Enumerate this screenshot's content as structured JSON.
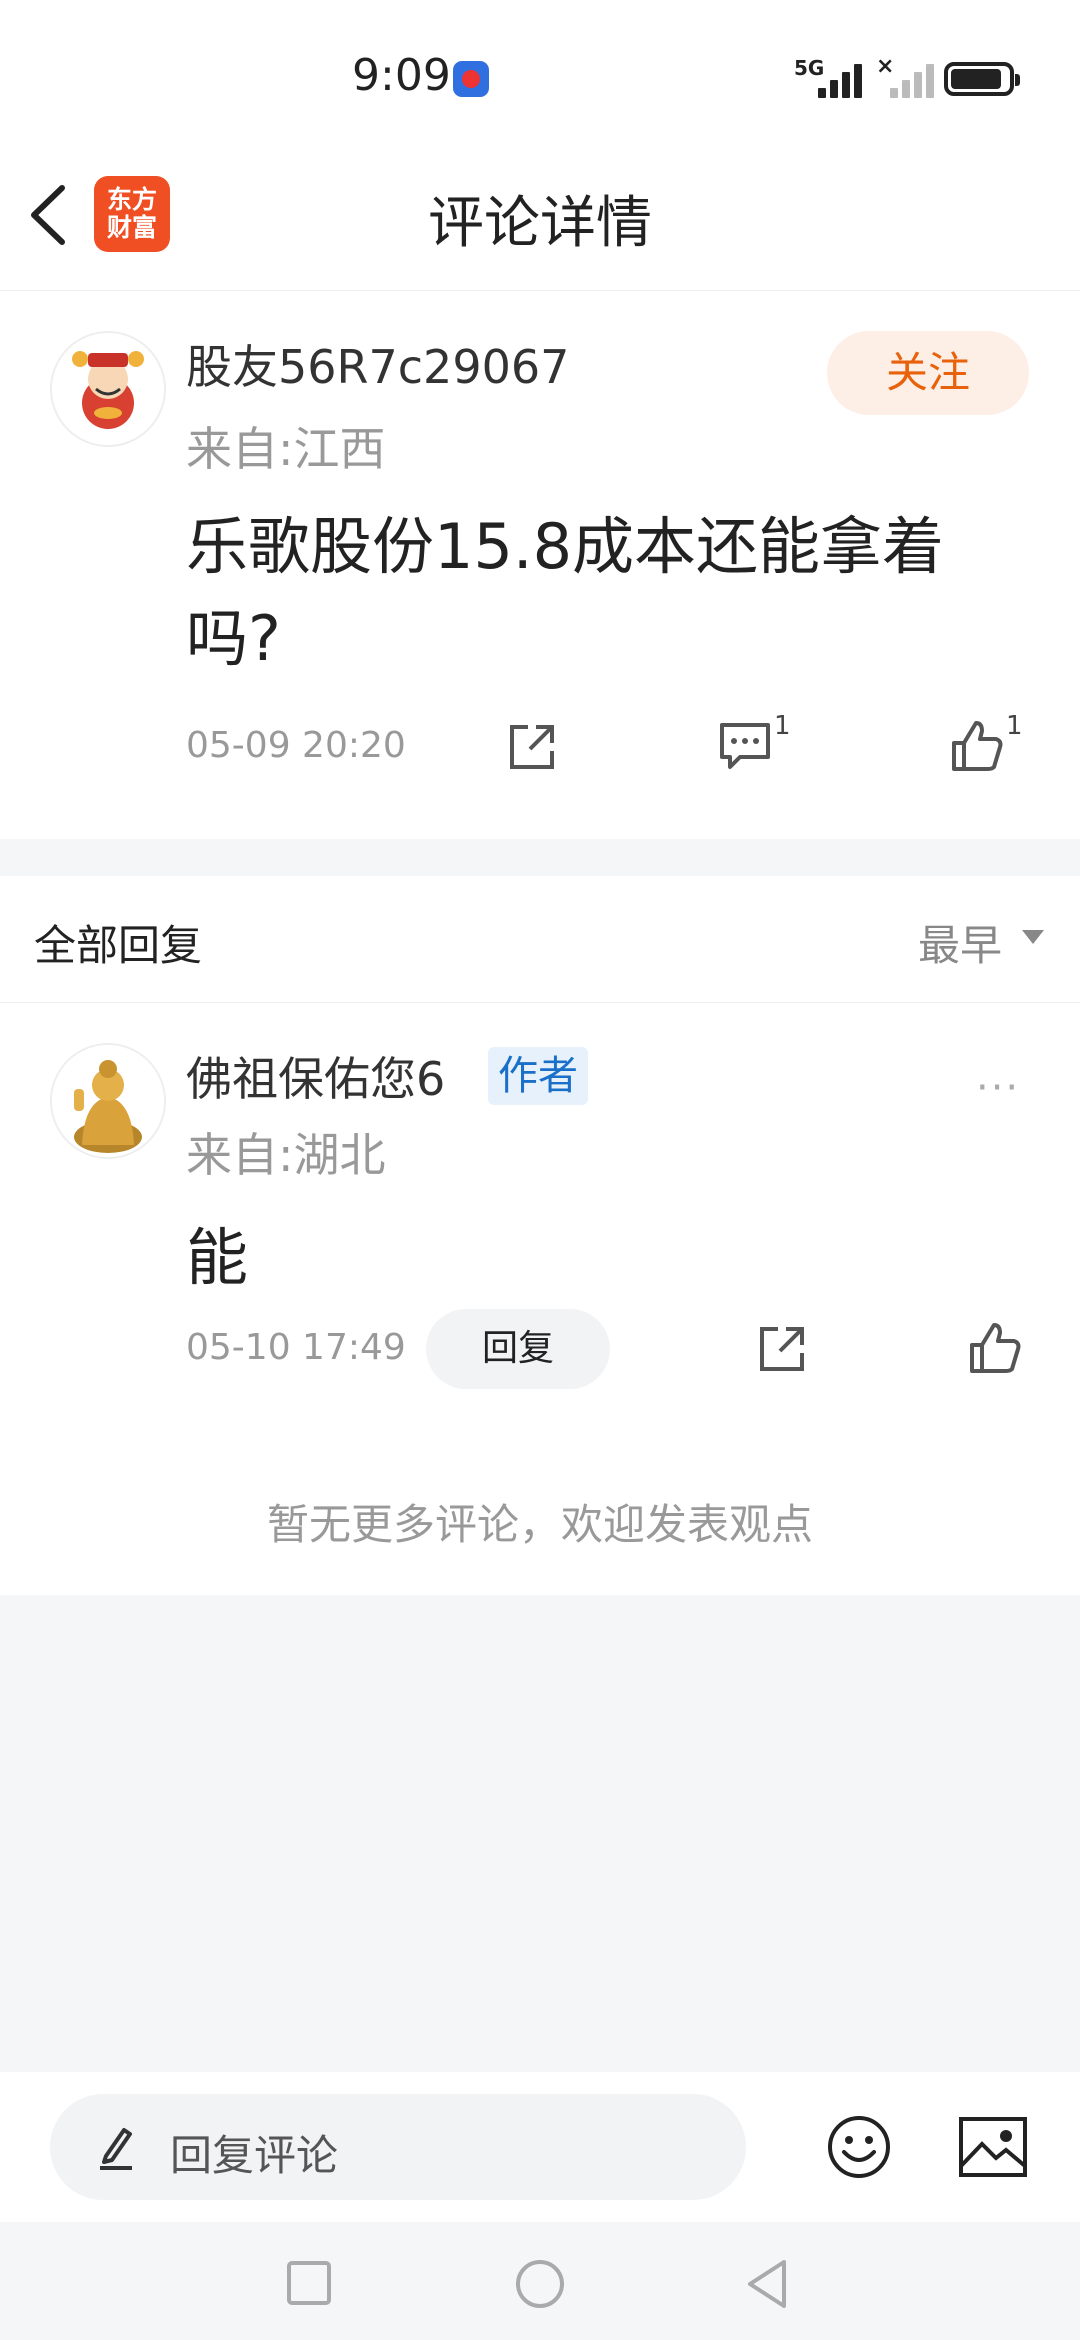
{
  "status_bar": {
    "time": "9:09",
    "network": "5G"
  },
  "header": {
    "title": "评论详情",
    "logo_line1": "东方",
    "logo_line2": "财富"
  },
  "post": {
    "username": "股友56R7c29067",
    "location": "来自:江西",
    "follow_label": "关注",
    "content": "乐歌股份15.8成本还能拿着吗?",
    "timestamp": "05-09 20:20",
    "comment_count": "1",
    "like_count": "1"
  },
  "replies": {
    "header_label": "全部回复",
    "sort_label": "最早",
    "items": [
      {
        "username": "佛祖保佑您6",
        "author_tag": "作者",
        "location": "来自:湖北",
        "content": "能",
        "timestamp": "05-10 17:49",
        "reply_label": "回复",
        "more_label": "···"
      }
    ],
    "no_more_text": "暂无更多评论，欢迎发表观点"
  },
  "bottom_bar": {
    "input_placeholder": "回复评论"
  },
  "colors": {
    "brand": "#f04e23",
    "follow_text": "#e8620c",
    "author_tag": "#1a70c9"
  }
}
